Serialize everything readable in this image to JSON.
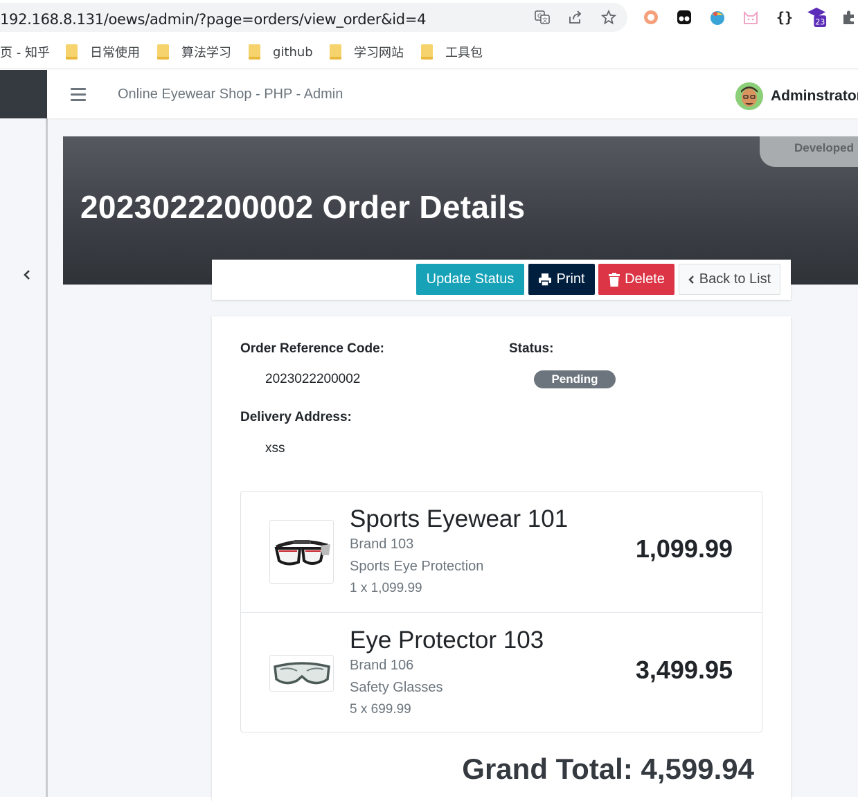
{
  "browser": {
    "url": "192.168.8.131/oews/admin/?page=orders/view_order&id=4",
    "extension_badge": "23",
    "bookmarks": [
      {
        "label": "页 - 知乎",
        "folder": false
      },
      {
        "label": "日常使用",
        "folder": true
      },
      {
        "label": "算法学习",
        "folder": true
      },
      {
        "label": "github",
        "folder": true
      },
      {
        "label": "学习网站",
        "folder": true
      },
      {
        "label": "工具包",
        "folder": true
      }
    ]
  },
  "topnav": {
    "title": "Online Eyewear Shop - PHP - Admin",
    "user_name": "Adminstrator"
  },
  "header": {
    "developed_label": "Developed",
    "page_title": "2023022200002 Order Details"
  },
  "actions": {
    "update_status": "Update Status",
    "print": "Print",
    "delete": "Delete",
    "back": "Back to List"
  },
  "order": {
    "ref_label": "Order Reference Code:",
    "ref_code": "2023022200002",
    "status_label": "Status:",
    "status": "Pending",
    "status_color": "#6c757d",
    "address_label": "Delivery Address:",
    "address": "xss",
    "items": [
      {
        "name": "Sports Eyewear 101",
        "brand": "Brand 103",
        "category": "Sports Eye Protection",
        "qty_price": "1 x 1,099.99",
        "total": "1,099.99"
      },
      {
        "name": "Eye Protector 103",
        "brand": "Brand 106",
        "category": "Safety Glasses",
        "qty_price": "5 x 699.99",
        "total": "3,499.95"
      }
    ],
    "grand_total": "Grand Total: 4,599.94"
  },
  "colors": {
    "info": "#17a2b8",
    "navy": "#001f3f",
    "danger": "#dc3545",
    "dark": "#343a40"
  }
}
